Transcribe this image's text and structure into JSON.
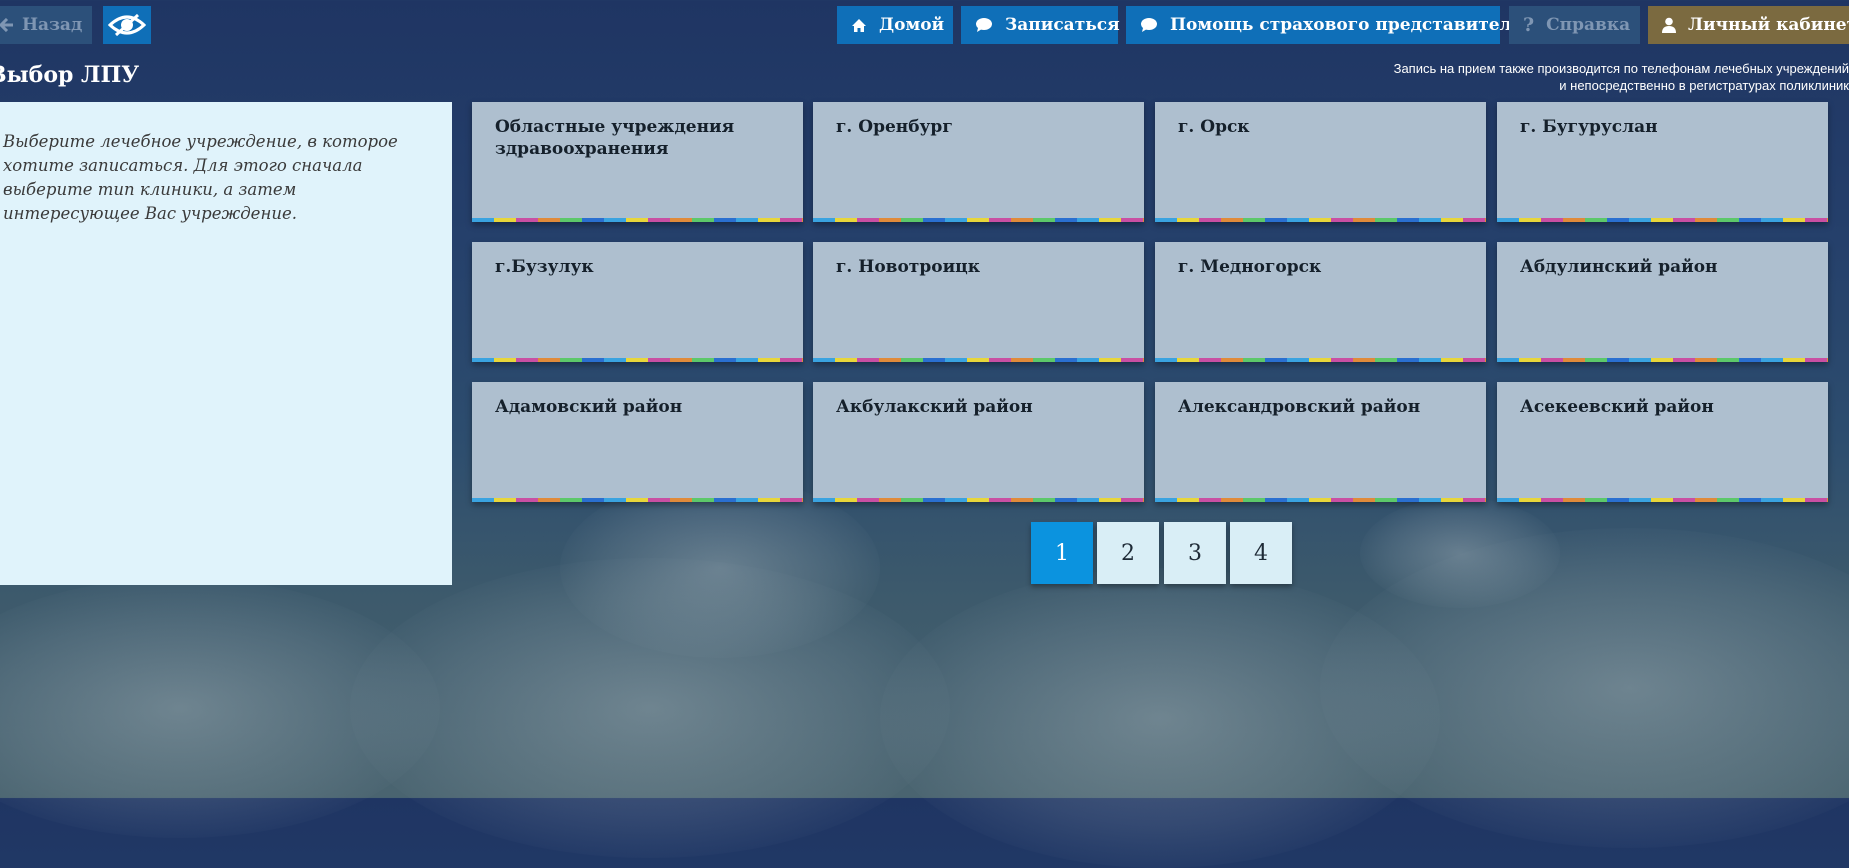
{
  "topbar": {
    "back_label": "Назад",
    "home_label": "Домой",
    "signup_label": "Записаться",
    "insurance_label": "Помощь страхового представителя",
    "help_label": "Справка",
    "cabinet_label": "Личный кабинет"
  },
  "page": {
    "title": "Выбор ЛПУ",
    "notice_line1": "Запись на прием также производится по телефонам лечебных учреждений",
    "notice_line2": "и непосредственно в регистратурах поликлиник"
  },
  "sidebar": {
    "instruction": "Выберите лечебное учреждение, в которое хотите записаться. Для этого сначала выберите тип клиники, а затем интересующее Вас учреждение."
  },
  "tiles": [
    "Областные учреждения здравоохранения",
    "г. Оренбург",
    "г. Орск",
    "г. Бугуруслан",
    "г.Бузулук",
    "г. Новотроицк",
    "г. Медногорск",
    "Абдулинский район",
    "Адамовский район",
    "Акбулакский район",
    "Александровский район",
    "Асекеевский район"
  ],
  "pagination": {
    "pages": [
      "1",
      "2",
      "3",
      "4"
    ],
    "current": "1"
  },
  "colors": {
    "accent_blue": "#0f6fb8",
    "active_page": "#0b93df",
    "cabinet": "#7b6a40"
  }
}
